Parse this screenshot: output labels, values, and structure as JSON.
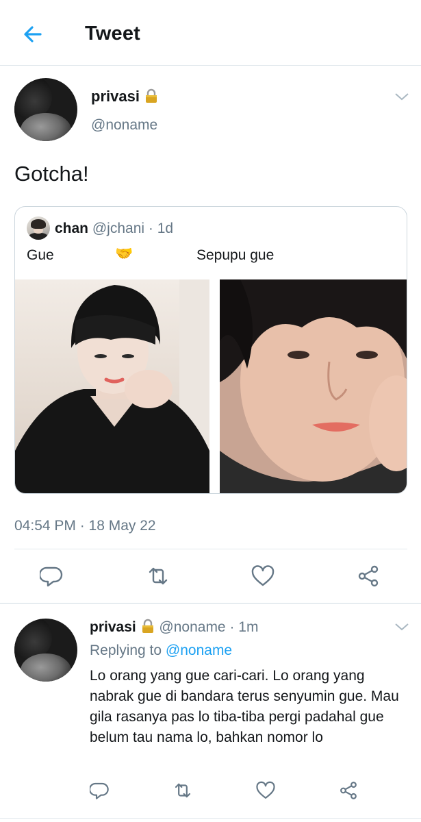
{
  "header": {
    "title": "Tweet"
  },
  "main_tweet": {
    "display_name": "privasi",
    "handle": "@noname",
    "text": "Gotcha!",
    "timestamp": "04:54 PM · 18 May 22"
  },
  "quoted_tweet": {
    "display_name": "chan",
    "handle": "@jchani",
    "time": "· 1d",
    "text_left": "Gue",
    "emoji": "🤝",
    "text_right": "Sepupu gue"
  },
  "actions": [
    "reply-icon",
    "retweet-icon",
    "like-icon",
    "share-icon"
  ],
  "reply": {
    "display_name": "privasi",
    "handle": "@noname",
    "time": "· 1m",
    "replying_prefix": "Replying to",
    "replying_handle": "@noname",
    "text": "Lo orang yang gue cari-cari. Lo orang yang nabrak gue di bandara terus senyumin gue. Mau gila rasanya pas lo tiba-tiba pergi padahal gue belum tau nama lo, bahkan nomor lo"
  },
  "colors": {
    "accent": "#1da1f2",
    "secondary_text": "#657786",
    "border": "#e1e8ed"
  }
}
